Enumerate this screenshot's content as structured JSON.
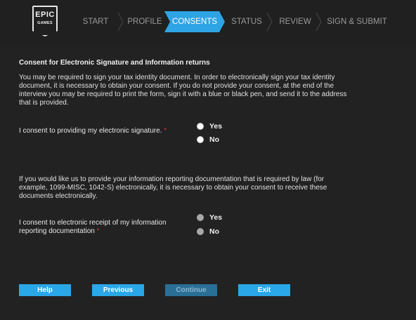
{
  "logo": {
    "line1": "EPIC",
    "line2": "GAMES"
  },
  "steps": [
    {
      "label": "START",
      "active": false
    },
    {
      "label": "PROFILE",
      "active": false
    },
    {
      "label": "CONSENTS",
      "active": true
    },
    {
      "label": "STATUS",
      "active": false
    },
    {
      "label": "REVIEW",
      "active": false
    },
    {
      "label": "SIGN & SUBMIT",
      "active": false
    }
  ],
  "section": {
    "title": "Consent for Electronic Signature and Information returns",
    "intro": "You may be required to sign your tax identity document. In order to electronically sign your tax identity document, it is necessary to obtain your consent. If you do not provide your consent, at the end of the interview you may be required to print the form, sign it with a blue or black pen, and send it to the address that is provided."
  },
  "question1": {
    "label": "I consent to providing my electronic signature.",
    "required_mark": "*",
    "options": [
      "Yes",
      "No"
    ]
  },
  "info_paragraph": "If you would like us to provide your information reporting documentation that is required by law (for example, 1099-MISC, 1042-S) electronically, it is necessary to obtain your consent to receive these documents electronically.",
  "question2": {
    "label": "I consent to electronic receipt of my information reporting documentation",
    "required_mark": "*",
    "options": [
      "Yes",
      "No"
    ],
    "disabled": true
  },
  "buttons": {
    "help": "Help",
    "previous": "Previous",
    "continue": "Continue",
    "exit": "Exit"
  },
  "colors": {
    "accent": "#2ea4e5",
    "background": "#222222",
    "required": "#e03030"
  }
}
